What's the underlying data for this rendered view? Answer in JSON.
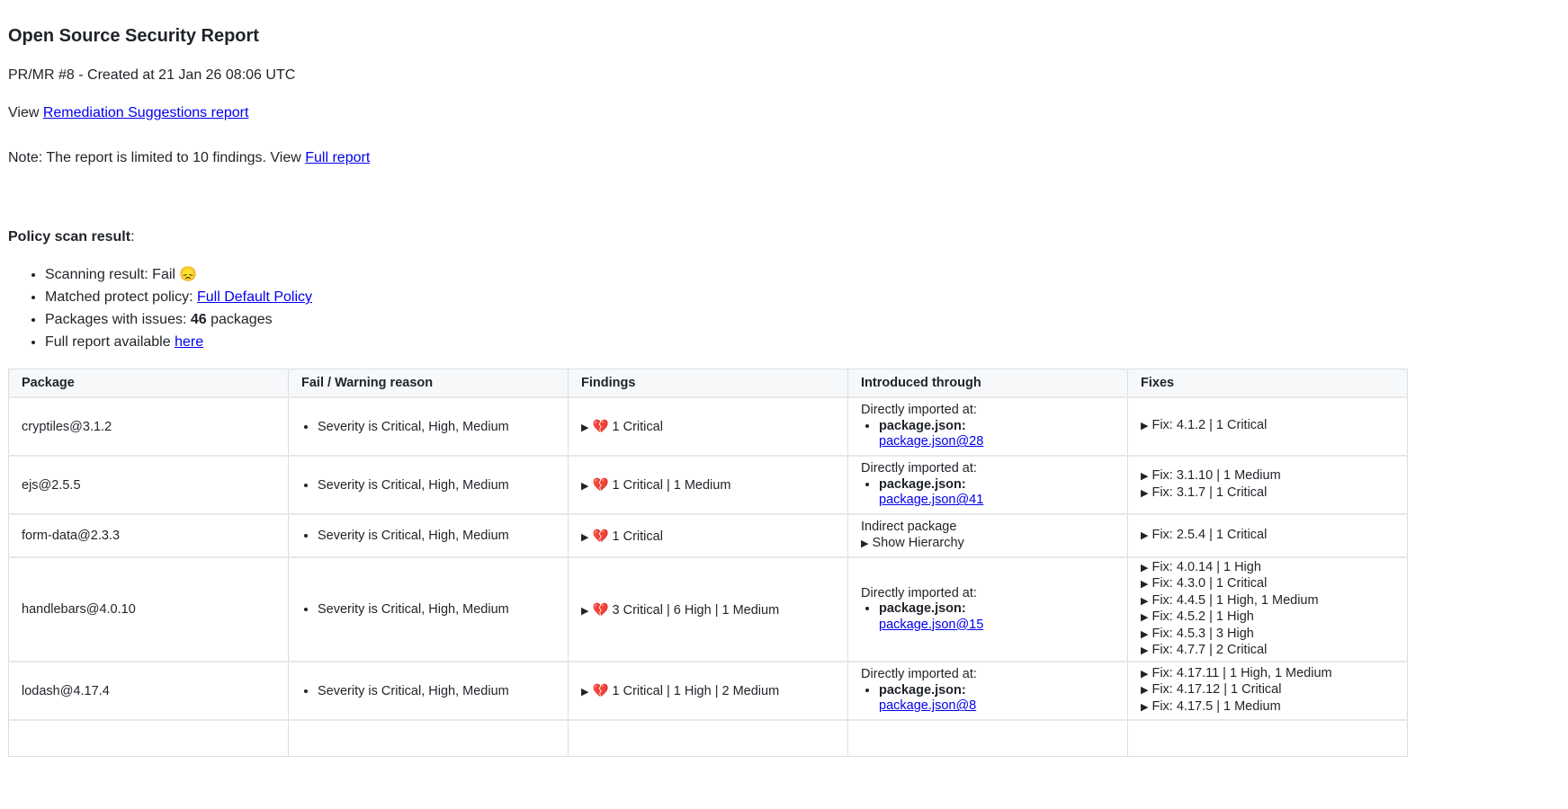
{
  "title": "Open Source Security Report",
  "subtitle": "PR/MR #8 - Created at 21 Jan 26 08:06 UTC",
  "view_prefix": "View",
  "remediation_link": "Remediation Suggestions report",
  "note_prefix": "Note: The report is limited to 10 findings. View",
  "note_link": "Full report",
  "policy": {
    "heading": "Policy scan result",
    "colon": ":",
    "scanning_label": "Scanning result: Fail",
    "scanning_emoji": "😞",
    "matched_label": "Matched protect policy:",
    "matched_link": "Full Default Policy",
    "packages_label": "Packages with issues:",
    "packages_count": "46",
    "packages_suffix": "packages",
    "full_label": "Full report available",
    "full_link": "here"
  },
  "table": {
    "headers": [
      "Package",
      "Fail / Warning reason",
      "Findings",
      "Introduced through",
      "Fixes"
    ],
    "direct_label": "Directly imported at:",
    "indirect_label": "Indirect package",
    "hierarchy_label": "Show Hierarchy",
    "manifest_label": "package.json:",
    "rows": [
      {
        "package": "cryptiles@3.1.2",
        "reason": "Severity is Critical, High, Medium",
        "findings": "1 Critical",
        "link": "package.json@28",
        "fixes": [
          "Fix: 4.1.2 | 1 Critical"
        ]
      },
      {
        "package": "ejs@2.5.5",
        "reason": "Severity is Critical, High, Medium",
        "findings": "1 Critical | 1 Medium",
        "link": "package.json@41",
        "fixes": [
          "Fix: 3.1.10 | 1 Medium",
          "Fix: 3.1.7 | 1 Critical"
        ]
      },
      {
        "package": "form-data@2.3.3",
        "reason": "Severity is Critical, High, Medium",
        "findings": "1 Critical",
        "fixes": [
          "Fix: 2.5.4 | 1 Critical"
        ]
      },
      {
        "package": "handlebars@4.0.10",
        "reason": "Severity is Critical, High, Medium",
        "findings": "3 Critical | 6 High | 1 Medium",
        "link": "package.json@15",
        "fixes": [
          "Fix: 4.0.14 | 1 High",
          "Fix: 4.3.0 | 1 Critical",
          "Fix: 4.4.5 | 1 High, 1 Medium",
          "Fix: 4.5.2 | 1 High",
          "Fix: 4.5.3 | 3 High",
          "Fix: 4.7.7 | 2 Critical"
        ]
      },
      {
        "package": "lodash@4.17.4",
        "reason": "Severity is Critical, High, Medium",
        "findings": "1 Critical | 1 High | 2 Medium",
        "link": "package.json@8",
        "fixes": [
          "Fix: 4.17.11 | 1 High, 1 Medium",
          "Fix: 4.17.12 | 1 Critical",
          "Fix: 4.17.5 | 1 Medium"
        ]
      }
    ]
  }
}
